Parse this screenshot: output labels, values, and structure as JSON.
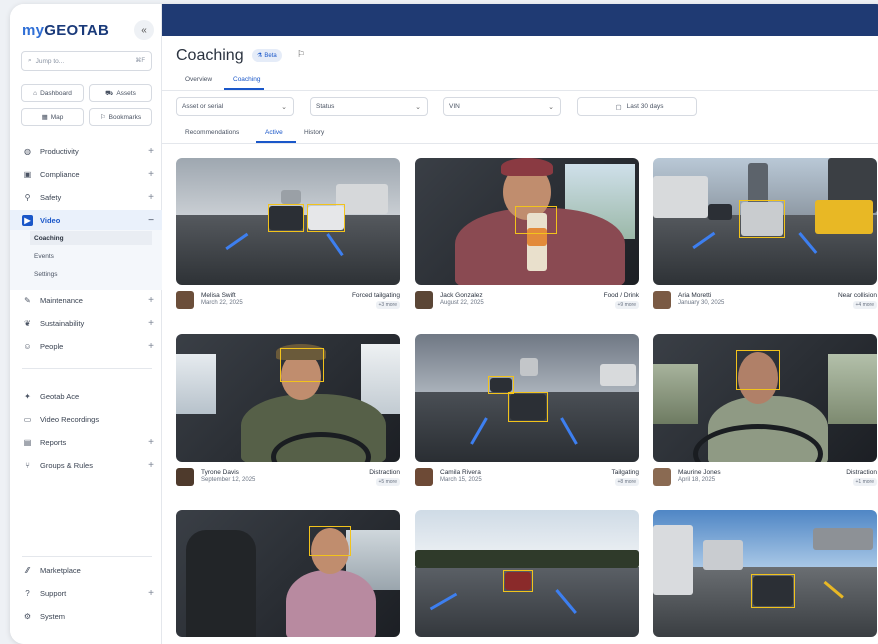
{
  "sidebar": {
    "logo_my": "my",
    "logo_rest": "GEOTAB",
    "collapse": "«",
    "jump_placeholder": "Jump to...",
    "jump_shortcut": "⌘F",
    "quick": {
      "dashboard": "Dashboard",
      "assets": "Assets",
      "map": "Map",
      "bookmarks": "Bookmarks"
    },
    "items": {
      "productivity": "Productivity",
      "compliance": "Compliance",
      "safety": "Safety",
      "video": "Video",
      "maintenance": "Maintenance",
      "sustainability": "Sustainability",
      "people": "People",
      "geotab_ace": "Geotab Ace",
      "video_recordings": "Video Recordings",
      "reports": "Reports",
      "groups_rules": "Groups & Rules",
      "marketplace": "Marketplace",
      "support": "Support",
      "system": "System"
    },
    "video_sub": {
      "coaching": "Coaching",
      "events": "Events",
      "settings": "Settings"
    }
  },
  "page": {
    "title": "Coaching",
    "beta": "Beta",
    "tabs": {
      "overview": "Overview",
      "coaching": "Coaching"
    },
    "filters": {
      "asset": "Asset or serial",
      "status": "Status",
      "vin": "VIN",
      "date": "Last 30 days"
    },
    "subtabs": {
      "recommendations": "Recommendations",
      "active": "Active",
      "history": "History"
    }
  },
  "cards": [
    {
      "name": "Melisa Swift",
      "date": "March 22, 2025",
      "event": "Forced tailgating",
      "more": "+3 more"
    },
    {
      "name": "Jack Gonzalez",
      "date": "August 22, 2025",
      "event": "Food / Drink",
      "more": "+9 more"
    },
    {
      "name": "Aria Moretti",
      "date": "January 30, 2025",
      "event": "Near collision",
      "more": "+4 more"
    },
    {
      "name": "Tyrone Davis",
      "date": "September 12, 2025",
      "event": "Distraction",
      "more": "+5 more"
    },
    {
      "name": "Camila Rivera",
      "date": "March 15, 2025",
      "event": "Tailgating",
      "more": "+8 more"
    },
    {
      "name": "Maurine Jones",
      "date": "April 18, 2025",
      "event": "Distraction",
      "more": "+1 more"
    }
  ],
  "colors": {
    "accent": "#1a57c9",
    "topbar": "#1f3a73",
    "detection": "#f2c31b",
    "lane": "#3d7ff0"
  },
  "icons": [
    "search-icon",
    "dashboard-icon",
    "assets-icon",
    "map-icon",
    "bookmark-icon",
    "productivity-icon",
    "compliance-icon",
    "safety-icon",
    "video-icon",
    "maintenance-icon",
    "sustainability-icon",
    "people-icon",
    "ace-icon",
    "recordings-icon",
    "reports-icon",
    "groups-icon",
    "marketplace-icon",
    "support-icon",
    "system-icon",
    "calendar-icon",
    "chevron-down-icon"
  ]
}
